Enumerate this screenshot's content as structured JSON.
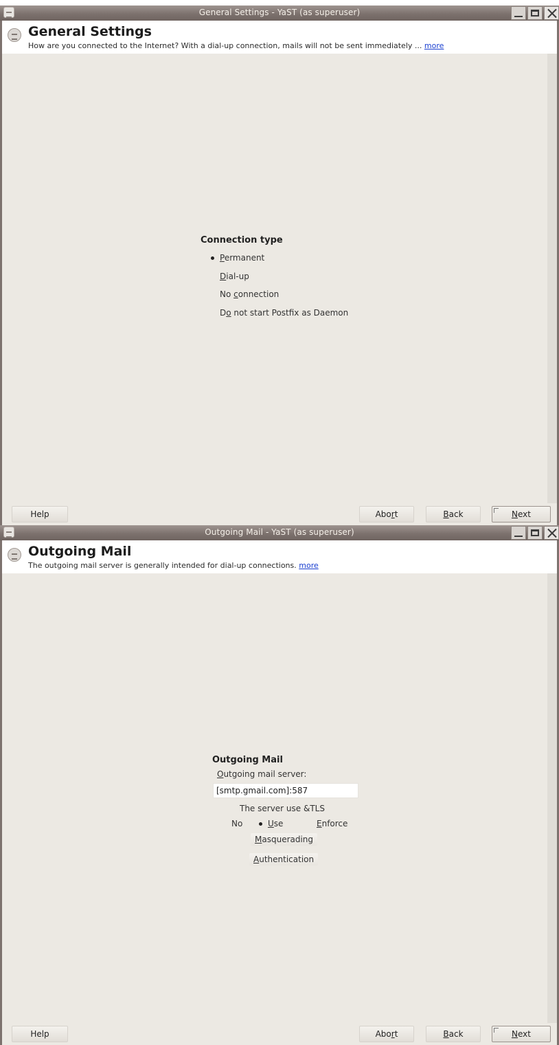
{
  "window1": {
    "title": "General Settings - YaST (as superuser)",
    "header_title": "General Settings",
    "header_desc": "How are you connected to the Internet? With a dial-up connection, mails will not be sent immediately ...",
    "more_link": "more",
    "group_title": "Connection type",
    "options": [
      {
        "pre": "",
        "acc": "P",
        "post": "ermanent",
        "selected": true
      },
      {
        "pre": "",
        "acc": "D",
        "post": "ial-up",
        "selected": false
      },
      {
        "pre": "No ",
        "acc": "c",
        "post": "onnection",
        "selected": false
      },
      {
        "pre": "D",
        "acc": "o",
        "post": " not start Postfix as Daemon",
        "selected": false
      }
    ],
    "footer": {
      "help": "Help",
      "abort": {
        "pre": "Abo",
        "acc": "r",
        "post": "t"
      },
      "back": {
        "pre": "",
        "acc": "B",
        "post": "ack"
      },
      "next": {
        "pre": "",
        "acc": "N",
        "post": "ext"
      }
    }
  },
  "window2": {
    "title": "Outgoing Mail - YaST (as superuser)",
    "header_title": "Outgoing Mail",
    "header_desc": "The outgoing mail server is generally intended for dial-up connections.",
    "more_link": "more",
    "group_title": "Outgoing Mail",
    "server_label": {
      "pre": "",
      "acc": "O",
      "post": "utgoing mail server:"
    },
    "server_value": "[smtp.gmail.com]:587",
    "tls_label": "The server use &TLS",
    "tls_options": [
      {
        "pre": "No",
        "acc": "",
        "post": "",
        "selected": false
      },
      {
        "pre": "",
        "acc": "U",
        "post": "se",
        "selected": true
      },
      {
        "pre": "",
        "acc": "E",
        "post": "nforce",
        "selected": false
      }
    ],
    "masquerading": {
      "pre": "",
      "acc": "M",
      "post": "asquerading"
    },
    "authentication": {
      "pre": "",
      "acc": "A",
      "post": "uthentication"
    },
    "footer": {
      "help": "Help",
      "abort": {
        "pre": "Abo",
        "acc": "r",
        "post": "t"
      },
      "back": {
        "pre": "",
        "acc": "B",
        "post": "ack"
      },
      "next": {
        "pre": "",
        "acc": "N",
        "post": "ext"
      }
    }
  }
}
